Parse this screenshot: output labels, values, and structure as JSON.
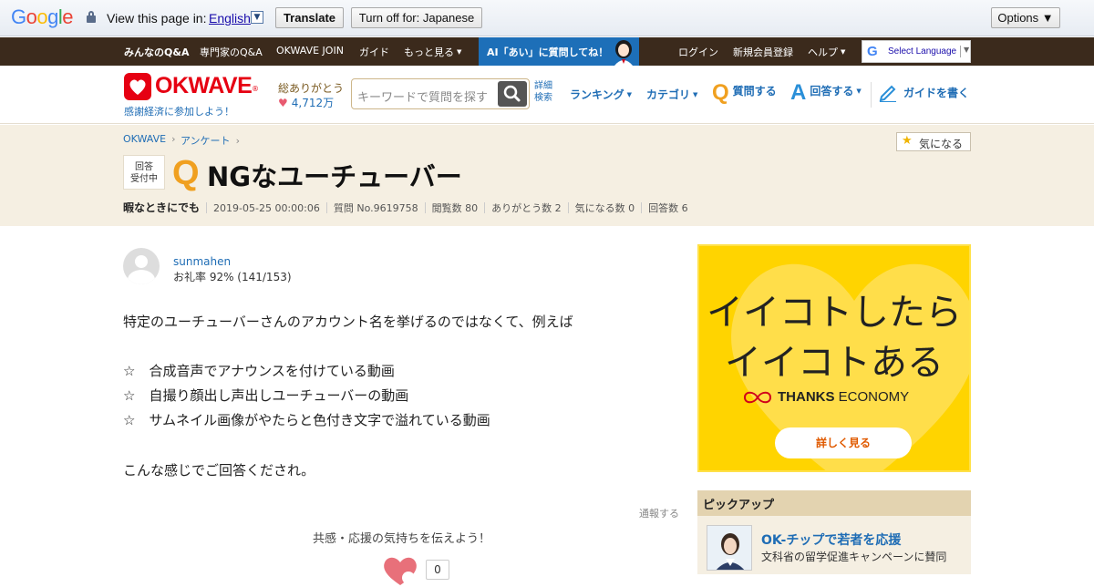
{
  "translate_bar": {
    "brand": "Google",
    "prompt": "View this page in:",
    "language": "English",
    "translate_button": "Translate",
    "turn_off_button": "Turn off for: Japanese",
    "options_button": "Options ▼"
  },
  "top_nav": {
    "items": [
      "みんなのQ&A",
      "専門家のQ&A",
      "OKWAVE JOIN",
      "ガイド",
      "もっと見る"
    ],
    "ai_banner": "AI「あい」に質問してね！",
    "right_items": [
      "ログイン",
      "新規会員登録",
      "ヘルプ"
    ],
    "select_language": "Select Language"
  },
  "header": {
    "logo_text": "OKWAVE",
    "logo_mark": "®",
    "slogan": "感謝経済に参加しよう！",
    "thanks_label": "総ありがとう",
    "thanks_count": "4,712万",
    "search_placeholder": "キーワードで質問を探す",
    "detail_search_1": "詳細",
    "detail_search_2": "検索",
    "nav": {
      "ranking": "ランキング",
      "category": "カテゴリ",
      "ask": "質問する",
      "answer": "回答する",
      "guide": "ガイドを書く"
    }
  },
  "question": {
    "breadcrumb": [
      "OKWAVE",
      "アンケート"
    ],
    "watch_button": "気になる",
    "status_1": "回答",
    "status_2": "受付中",
    "q_mark": "Q",
    "title": "NGなユーチューバー",
    "category": "暇なときにでも",
    "date": "2019-05-25 00:00:06",
    "question_no": "質問 No.9619758",
    "views": "閲覧数 80",
    "thanks": "ありがとう数 2",
    "watchers": "気になる数 0",
    "answers": "回答数 6"
  },
  "author": {
    "name": "sunmahen",
    "rate": "お礼率 92%   (141/153)"
  },
  "body": [
    "特定のユーチューバーさんのアカウント名を挙げるのではなくて、例えば",
    "☆　合成音声でアナウンスを付けている動画",
    "☆　自撮り顔出し声出しユーチューバーの動画",
    "☆　サムネイル画像がやたらと色付き文字で溢れている動画",
    "こんな感じでご回答くだされ。"
  ],
  "report_link": "通報する",
  "empathy_prompt": "共感・応援の気持ちを伝えよう！",
  "empathy_count": "0",
  "ad": {
    "line1": "イイコトしたら",
    "line2": "イイコトある",
    "brand_bold": "THANKS",
    "brand_rest": " ECONOMY",
    "cta": "詳しく見る",
    "bg_color": "#ffd400"
  },
  "pickup": {
    "heading": "ピックアップ",
    "title": "OK-チップで若者を応援",
    "subtitle": "文科省の留学促進キャンペーンに賛同"
  }
}
